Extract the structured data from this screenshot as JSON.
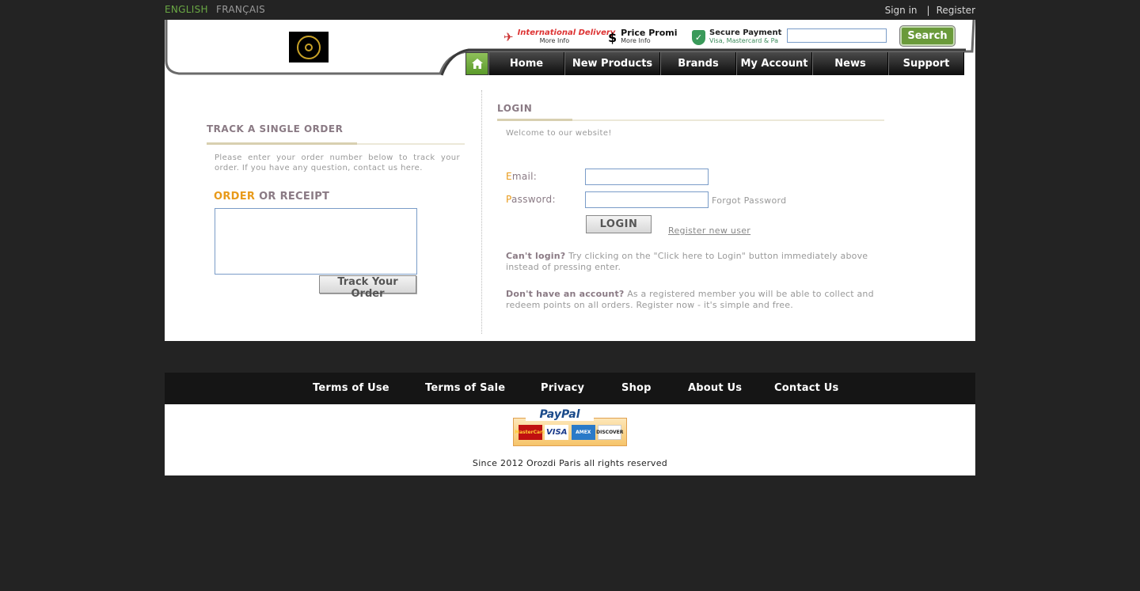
{
  "top": {
    "languages": [
      "ENGLISH",
      "FRANÇAIS"
    ],
    "sign_in": "Sign in",
    "separator": "|",
    "register": "Register"
  },
  "header": {
    "promos": {
      "intl": {
        "title": "International Delivery",
        "sub": "More Info"
      },
      "price": {
        "title": "Price Promi",
        "sub": "More Info"
      },
      "secure": {
        "title": "Secure Payment",
        "sub": "Visa, Mastercard & Pa"
      }
    },
    "search_button": "Search",
    "search_value": ""
  },
  "nav": {
    "items": [
      "Home",
      "New Products",
      "Brands",
      "My Account",
      "News",
      "Support"
    ]
  },
  "track": {
    "title": "TRACK A SINGLE ORDER",
    "description": "Please enter your order number below to track your order. If you have any question, contact us here.",
    "label_highlight": "ORDER",
    "label_rest": " OR RECEIPT",
    "button": "Track Your Order"
  },
  "login": {
    "title": "LOGIN",
    "welcome": "Welcome to our website!",
    "email_first": "E",
    "email_rest": "mail:",
    "password_first": "P",
    "password_rest": "assword:",
    "forgot": "Forgot Password",
    "button": "LOGIN",
    "register": "Register new user",
    "cant_bold": "Can't login?",
    "cant_text": " Try clicking on the \"Click here to Login\" button immediately above instead of pressing enter.",
    "dont_bold": "Don't have an account?",
    "dont_text": " As a registered member you will be able to collect and redeem points on all orders. Register now - it's simple and free."
  },
  "footer": {
    "links": [
      "Terms of Use",
      "Terms of Sale",
      "Privacy",
      "Shop",
      "About Us",
      "Contact Us"
    ],
    "paypal": "PayPal",
    "cards": [
      "MasterCard",
      "VISA",
      "AMEX",
      "DISCOVER"
    ],
    "copyright": "Since 2012 Orozdi Paris all rights reserved"
  },
  "colors": {
    "background": "#232323",
    "accent_green": "#6a9a3a",
    "accent_orange": "#e89a1a",
    "nav_dark": "#0d0d0d"
  },
  "icons": {
    "home": "home-icon",
    "plane": "airplane-icon",
    "dollar": "dollar-icon",
    "shield": "shield-icon",
    "resize": "resize-grip-icon"
  }
}
